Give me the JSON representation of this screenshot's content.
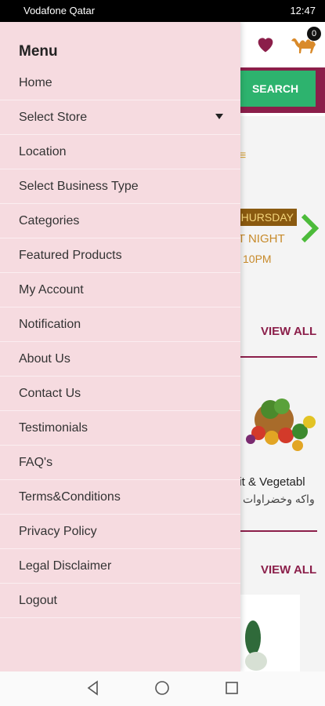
{
  "status_bar": {
    "carrier": "Vodafone Qatar",
    "time": "12:47"
  },
  "header": {
    "search_label": "SEARCH",
    "cart_count": "0"
  },
  "banner": {
    "day": "HURSDAY",
    "line2": "AT NIGHT",
    "line3": "10PM"
  },
  "sections": {
    "view_all_1": "VIEW ALL",
    "view_all_2": "VIEW ALL"
  },
  "category": {
    "name_en": "uit & Vegetabl",
    "name_ar": "واكه وخضراوات"
  },
  "drawer": {
    "title": "Menu",
    "items": [
      {
        "label": "Home"
      },
      {
        "label": "Select Store"
      },
      {
        "label": "Location"
      },
      {
        "label": "Select Business Type"
      },
      {
        "label": "Categories"
      },
      {
        "label": "Featured Products"
      },
      {
        "label": "My Account"
      },
      {
        "label": "Notification"
      },
      {
        "label": "About Us"
      },
      {
        "label": "Contact Us"
      },
      {
        "label": "Testimonials"
      },
      {
        "label": "FAQ's"
      },
      {
        "label": "Terms&Conditions"
      },
      {
        "label": "Privacy Policy"
      },
      {
        "label": "Legal Disclaimer"
      },
      {
        "label": "Logout"
      }
    ]
  },
  "colors": {
    "brand": "#8b1f4a",
    "accent": "#2db36e",
    "drawer_bg": "#f6dbe0"
  }
}
